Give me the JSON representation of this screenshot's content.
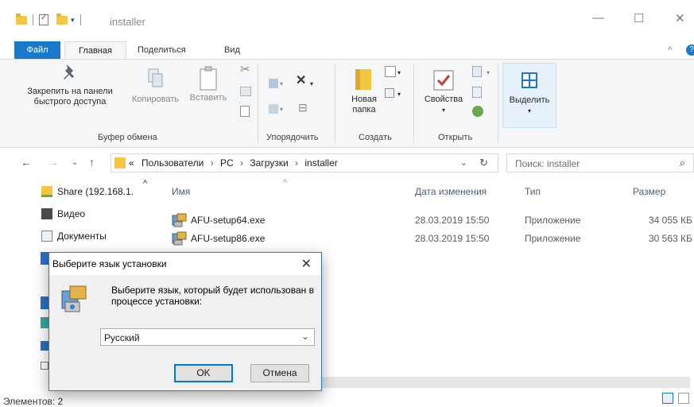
{
  "window": {
    "title": "installer",
    "minimize": "—",
    "maximize": "☐",
    "close": "✕"
  },
  "ribbon_tabs": {
    "file": "Файл",
    "home": "Главная",
    "share": "Поделиться",
    "view": "Вид"
  },
  "ribbon": {
    "pin": "Закрепить на панели быстрого доступа",
    "copy": "Копировать",
    "paste": "Вставить",
    "clipboard_group": "Буфер обмена",
    "organize_group": "Упорядочить",
    "new_folder": "Новая папка",
    "create_group": "Создать",
    "properties": "Свойства",
    "open_group": "Открыть",
    "select": "Выделить"
  },
  "address": {
    "overflow": "«",
    "crumbs": [
      "Пользователи",
      "PC",
      "Загрузки",
      "installer"
    ],
    "search_placeholder": "Поиск: installer"
  },
  "nav_pane": {
    "items": [
      "Share (192.168.1.",
      "Видео",
      "Документы"
    ]
  },
  "file_list": {
    "columns": {
      "name": "Имя",
      "date": "Дата изменения",
      "type": "Тип",
      "size": "Размер"
    },
    "rows": [
      {
        "name": "AFU-setup64.exe",
        "date": "28.03.2019 15:50",
        "type": "Приложение",
        "size": "34 055 КБ"
      },
      {
        "name": "AFU-setup86.exe",
        "date": "28.03.2019 15:50",
        "type": "Приложение",
        "size": "30 563 КБ"
      }
    ]
  },
  "status": {
    "items": "Элементов: 2"
  },
  "dialog": {
    "title": "Выберите язык установки",
    "message": "Выберите язык, который будет использован в процессе установки:",
    "language": "Русский",
    "ok": "OK",
    "cancel": "Отмена"
  },
  "colors": {
    "accent": "#1979ca",
    "folder": "#f3c744",
    "dialog_border": "#2b7bd0"
  }
}
